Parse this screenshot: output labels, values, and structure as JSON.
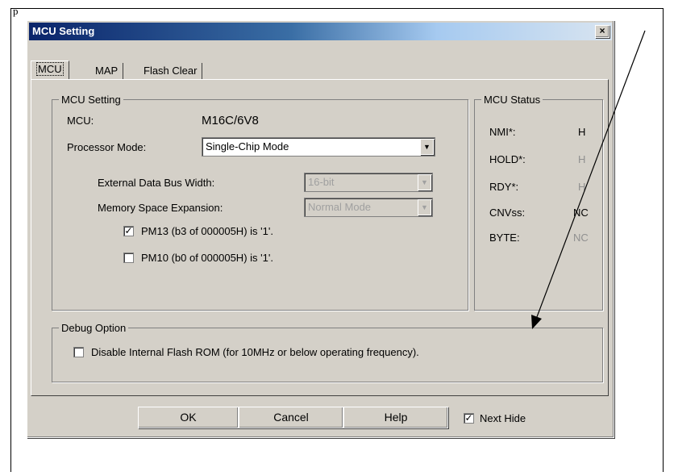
{
  "page": {
    "top_caption": "p"
  },
  "dialog": {
    "title": "MCU Setting",
    "close_glyph": "×",
    "tabs": [
      {
        "label": "MCU",
        "selected": true
      },
      {
        "label": "MAP",
        "selected": false
      },
      {
        "label": "Flash Clear",
        "selected": false
      }
    ],
    "mcu_setting": {
      "group_title": "MCU Setting",
      "mcu_label": "MCU:",
      "mcu_value": "M16C/6V8",
      "processor_mode_label": "Processor Mode:",
      "processor_mode_value": "Single-Chip Mode",
      "ext_bus_label": "External Data Bus Width:",
      "ext_bus_value": "16-bit",
      "mem_expansion_label": "Memory Space Expansion:",
      "mem_expansion_value": "Normal Mode",
      "pm13_label": "PM13 (b3 of 000005H) is '1'.",
      "pm13_checked": true,
      "pm10_label": "PM10 (b0 of 000005H) is '1'.",
      "pm10_checked": false
    },
    "mcu_status": {
      "group_title": "MCU Status",
      "rows": [
        {
          "name": "NMI*:",
          "value": "H",
          "enabled": true
        },
        {
          "name": "HOLD*:",
          "value": "H",
          "enabled": false
        },
        {
          "name": "RDY*:",
          "value": "H",
          "enabled": false
        },
        {
          "name": "CNVss:",
          "value": "NC",
          "enabled": true
        },
        {
          "name": "BYTE:",
          "value": "NC",
          "enabled": false
        }
      ]
    },
    "debug_option": {
      "group_title": "Debug Option",
      "disable_flash_label": "Disable Internal Flash ROM (for 10MHz or below operating frequency).",
      "disable_flash_checked": false
    },
    "buttons": {
      "ok": "OK",
      "cancel": "Cancel",
      "help": "Help"
    },
    "next_hide": {
      "label": "Next Hide",
      "checked": true
    }
  }
}
